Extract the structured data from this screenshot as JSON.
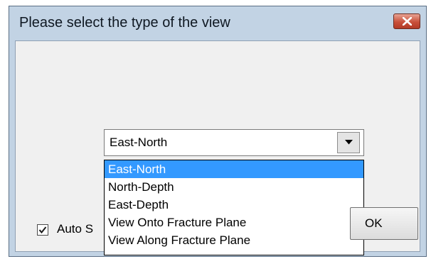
{
  "window": {
    "title": "Please select the type of the view",
    "close_icon": "close-x-icon"
  },
  "view_type": {
    "selected_value": "East-North",
    "arrow_icon": "chevron-down-icon",
    "options": [
      "East-North",
      "North-Depth",
      "East-Depth",
      "View Onto Fracture Plane",
      "View Along Fracture Plane"
    ],
    "highlighted_option": "East-North",
    "highlight_color": "#3399ff"
  },
  "auto_checkbox": {
    "label": "Auto S",
    "checked": true
  },
  "buttons": {
    "ok_label": "OK"
  },
  "colors": {
    "titlebar": "#c2d3e4",
    "close_button": "#c9503a"
  }
}
